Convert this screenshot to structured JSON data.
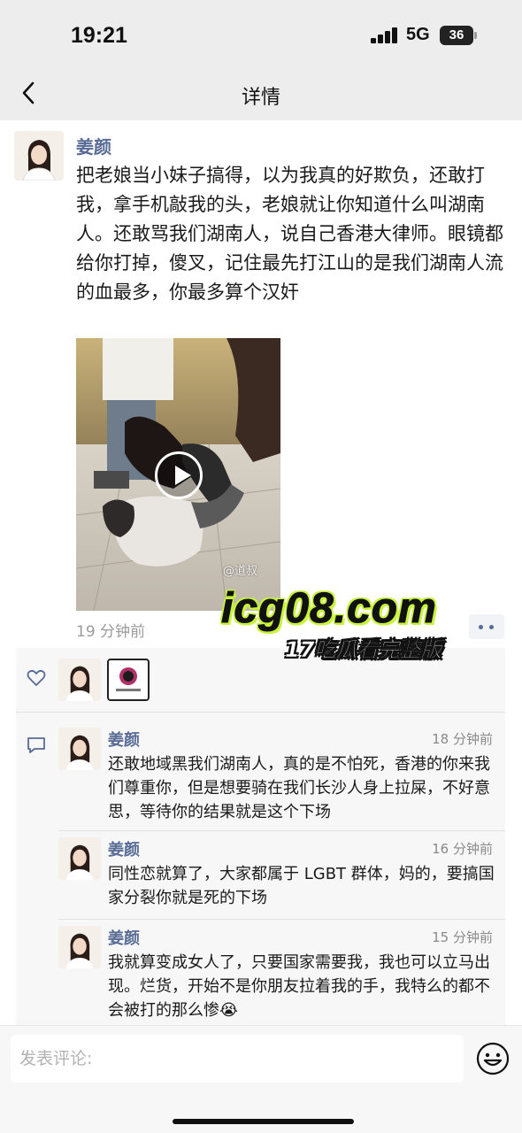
{
  "status_bar": {
    "time": "19:21",
    "network": "5G",
    "battery": "36"
  },
  "nav": {
    "title": "详情",
    "back_icon": "chevron-left-icon"
  },
  "post": {
    "author": "姜颜",
    "text": "把老娘当小妹子搞得，以为我真的好欺负，还敢打我，拿手机敲我的头，老娘就让你知道什么叫湖南人。还敢骂我们湖南人，说自己香港大律师。眼镜都给你打掉，傻叉，记住最先打江山的是我们湖南人流的血最多，你最多算个汉奸",
    "video_watermark": "@道叔",
    "time": "19 分钟前"
  },
  "promo": {
    "site": "icg08.com",
    "tagline": "17吃瓜看完整版"
  },
  "likes": {
    "icon": "heart-icon"
  },
  "comments": [
    {
      "author": "姜颜",
      "time": "18 分钟前",
      "text": "还敢地域黑我们湖南人，真的是不怕死，香港的你来我们尊重你，但是想要骑在我们长沙人身上拉屎，不好意思，等待你的结果就是这个下场"
    },
    {
      "author": "姜颜",
      "time": "16 分钟前",
      "text": "同性恋就算了，大家都属于 LGBT 群体，妈的，要搞国家分裂你就是死的下场"
    },
    {
      "author": "姜颜",
      "time": "15 分钟前",
      "text": "我就算变成女人了，只要国家需要我，我也可以立马出现。烂货，开始不是你朋友拉着我的手，我特么的都不会被打的那么惨😭"
    }
  ],
  "input": {
    "placeholder": "发表评论:"
  },
  "colors": {
    "author_link": "#576b95",
    "promo_accent": "#c7f33a",
    "background_grey": "#ededed"
  }
}
